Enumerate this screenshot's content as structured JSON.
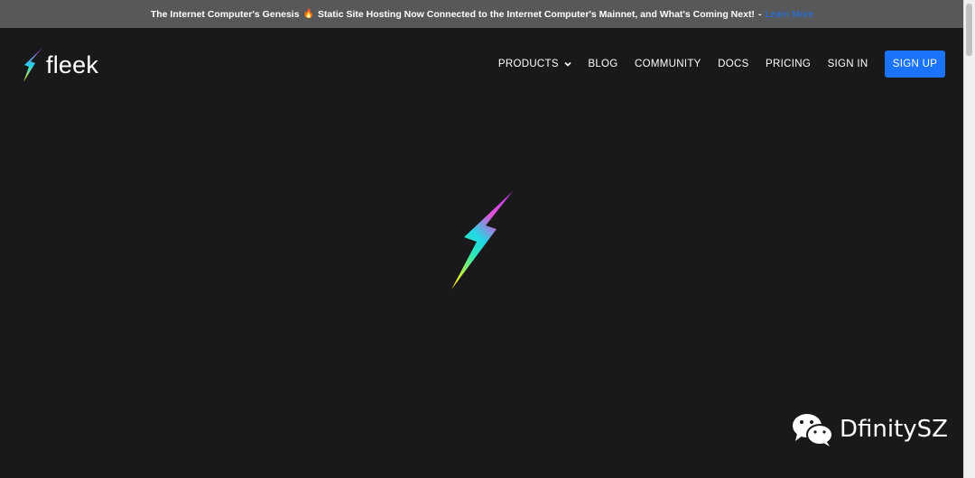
{
  "banner": {
    "text_before": "The Internet Computer's Genesis",
    "fire_emoji": "🔥",
    "text_after": "Static Site Hosting Now Connected to the Internet Computer's Mainnet, and What's Coming Next!",
    "separator": "-",
    "link_label": "Learn More"
  },
  "header": {
    "logo_text": "fleek",
    "nav": {
      "products": "PRODUCTS",
      "blog": "BLOG",
      "community": "COMMUNITY",
      "docs": "DOCS",
      "pricing": "PRICING",
      "sign_in": "SIGN IN",
      "sign_up": "SIGN UP"
    }
  },
  "watermark": {
    "text": "DfinitySZ",
    "icon": "wechat-icon"
  },
  "colors": {
    "background": "#19181b",
    "banner_bg": "#57585a",
    "accent": "#1a73f8",
    "bolt_gradient": [
      "#d63ee6",
      "#22d0e8",
      "#f2ef1e"
    ]
  }
}
